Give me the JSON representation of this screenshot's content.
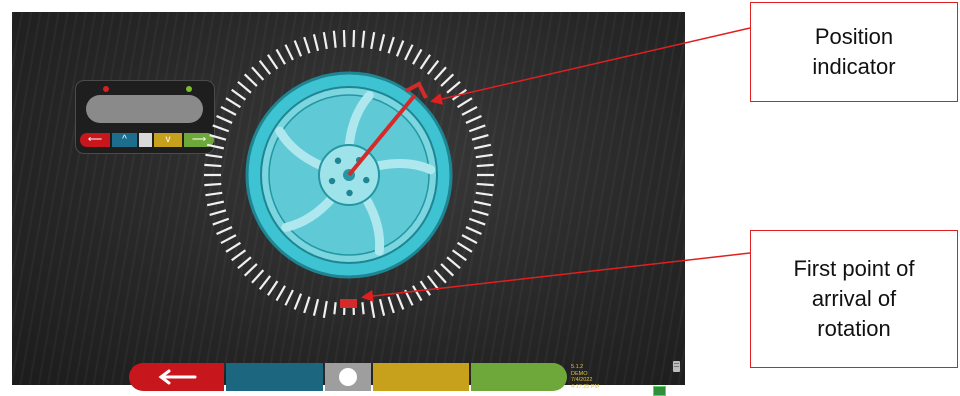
{
  "controls": {
    "left_arrow": "⟵",
    "up": "^",
    "down": "v",
    "right_arrow": "⟶"
  },
  "bottom_bar": {
    "back_arrow": "⟵"
  },
  "info": {
    "version": "5.1.2",
    "mode": "DEMO",
    "date": "7/4/2022",
    "time": "4:17:25 PM"
  },
  "callouts": {
    "position_indicator": "Position\nindicator",
    "first_point": "First point of\narrival of\nrotation"
  },
  "colors": {
    "wheel": "#3ec3d2",
    "indicator": "#d32a2a",
    "accent_red": "#c8161d",
    "accent_blue": "#1d6680",
    "accent_yellow": "#c8a11c",
    "accent_green": "#6fa83a"
  },
  "icons": [
    "back-arrow-icon",
    "up-chevron-icon",
    "down-chevron-icon",
    "forward-arrow-icon",
    "device-icon",
    "status-icon"
  ]
}
